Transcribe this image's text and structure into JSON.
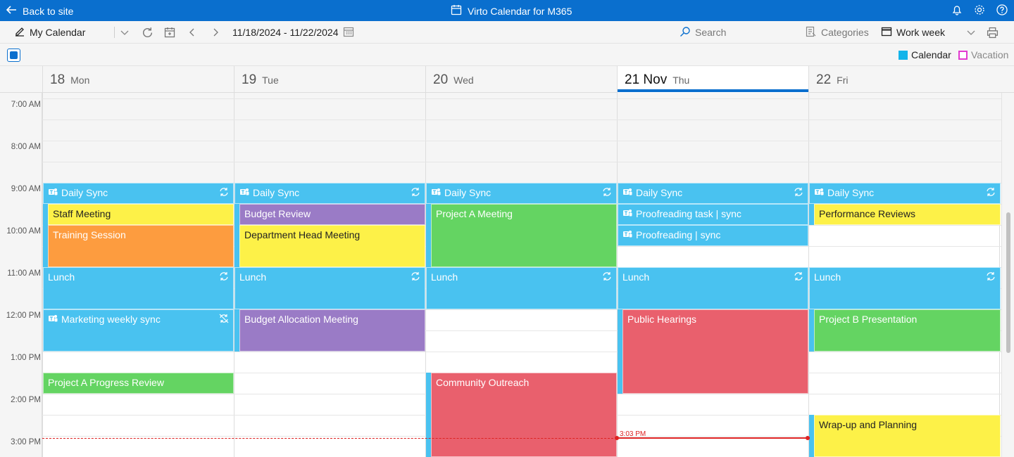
{
  "topbar": {
    "back_label": "Back to site",
    "app_title": "Virto Calendar for M365"
  },
  "toolbar": {
    "calendar_name": "My Calendar",
    "date_range": "11/18/2024 - 11/22/2024",
    "search_placeholder": "Search",
    "categories_label": "Categories",
    "view_label": "Work week"
  },
  "legend": [
    {
      "label": "Calendar",
      "color": "#13b4ea"
    },
    {
      "label": "Vacation",
      "color": "#e23ad0"
    }
  ],
  "days": [
    {
      "num": "18",
      "weekday": "Mon"
    },
    {
      "num": "19",
      "weekday": "Tue"
    },
    {
      "num": "20",
      "weekday": "Wed"
    },
    {
      "num": "21 Nov",
      "weekday": "Thu"
    },
    {
      "num": "22",
      "weekday": "Fri"
    }
  ],
  "times": [
    "7:00 AM",
    "8:00 AM",
    "9:00 AM",
    "10:00 AM",
    "11:00 AM",
    "12:00 PM",
    "1:00 PM",
    "2:00 PM",
    "3:00 PM"
  ],
  "events": {
    "mon": {
      "daily_sync": "Daily Sync",
      "staff_meeting": "Staff Meeting",
      "training": "Training Session",
      "lunch": "Lunch",
      "marketing": "Marketing weekly sync",
      "progress_review": "Project A Progress Review"
    },
    "tue": {
      "daily_sync": "Daily Sync",
      "budget_review": "Budget Review",
      "dept_head": "Department Head Meeting",
      "lunch": "Lunch",
      "budget_alloc": "Budget Allocation Meeting"
    },
    "wed": {
      "daily_sync": "Daily Sync",
      "project_a": "Project A Meeting",
      "lunch": "Lunch",
      "outreach": "Community Outreach"
    },
    "thu": {
      "daily_sync": "Daily Sync",
      "proof_task": "Proofreading task | sync",
      "proof_sync": "Proofreading | sync",
      "lunch": "Lunch",
      "hearings": "Public Hearings"
    },
    "fri": {
      "daily_sync": "Daily Sync",
      "perf_reviews": "Performance Reviews",
      "lunch": "Lunch",
      "project_b": "Project B Presentation",
      "wrapup": "Wrap-up and Planning"
    }
  },
  "current_time": "3:03 PM",
  "colors": {
    "accent": "#0a6fce",
    "teams_blue": "#49c2f0",
    "yellow": "#fdf148",
    "purple": "#9a7bc6",
    "orange": "#fd9c3f",
    "green": "#64d462",
    "red": "#e9606d"
  }
}
